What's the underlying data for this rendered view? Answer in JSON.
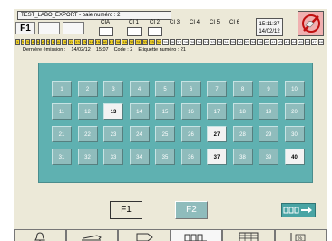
{
  "header": {
    "title": "TEST_LABO_EXPORT  - baie numéro : 2",
    "f_label": "F1",
    "columns": [
      "CIA",
      "CI 1",
      "CI 2",
      "CI 3",
      "CI 4",
      "CI 5",
      "CI 6"
    ],
    "clock_time": "15:11:37",
    "clock_date": "14/02/12",
    "close_icon": "no-entry-icon"
  },
  "markers": {
    "items": [
      "1",
      "2",
      "3",
      "4",
      "5",
      "6",
      "7",
      "8",
      "9",
      "10",
      "11",
      "12",
      "13",
      "14",
      "15",
      "16",
      "17",
      "18",
      "19",
      "20",
      "21",
      "22",
      "23",
      "24",
      "25",
      "26",
      "27",
      "28",
      "29",
      "30",
      "31",
      "32",
      "33",
      "34",
      "35",
      "36",
      "37",
      "38",
      "39",
      "40",
      "41",
      "42",
      "43",
      "44",
      "45",
      "46",
      "47",
      "48"
    ],
    "yellow_count": 24
  },
  "info": {
    "last_emission_label": "Dernière émission :",
    "last_emission_date": "14/02/12",
    "last_emission_time": "15:07",
    "code_label": "Code : 2",
    "label_number": "Etiquette numéro : 21"
  },
  "grid": {
    "cells": [
      {
        "n": "1",
        "sel": false
      },
      {
        "n": "2",
        "sel": false
      },
      {
        "n": "3",
        "sel": false
      },
      {
        "n": "4",
        "sel": false
      },
      {
        "n": "5",
        "sel": false
      },
      {
        "n": "6",
        "sel": false
      },
      {
        "n": "7",
        "sel": false
      },
      {
        "n": "8",
        "sel": false
      },
      {
        "n": "9",
        "sel": false
      },
      {
        "n": "10",
        "sel": false
      },
      {
        "n": "11",
        "sel": false
      },
      {
        "n": "12",
        "sel": false
      },
      {
        "n": "13",
        "sel": true
      },
      {
        "n": "14",
        "sel": false
      },
      {
        "n": "15",
        "sel": false
      },
      {
        "n": "16",
        "sel": false
      },
      {
        "n": "17",
        "sel": false
      },
      {
        "n": "18",
        "sel": false
      },
      {
        "n": "19",
        "sel": false
      },
      {
        "n": "20",
        "sel": false
      },
      {
        "n": "21",
        "sel": false
      },
      {
        "n": "22",
        "sel": false
      },
      {
        "n": "23",
        "sel": false
      },
      {
        "n": "24",
        "sel": false
      },
      {
        "n": "25",
        "sel": false
      },
      {
        "n": "26",
        "sel": false
      },
      {
        "n": "27",
        "sel": true
      },
      {
        "n": "28",
        "sel": false
      },
      {
        "n": "29",
        "sel": false
      },
      {
        "n": "30",
        "sel": false
      },
      {
        "n": "31",
        "sel": false
      },
      {
        "n": "32",
        "sel": false
      },
      {
        "n": "33",
        "sel": false
      },
      {
        "n": "34",
        "sel": false
      },
      {
        "n": "35",
        "sel": false
      },
      {
        "n": "36",
        "sel": false
      },
      {
        "n": "37",
        "sel": true
      },
      {
        "n": "38",
        "sel": false
      },
      {
        "n": "39",
        "sel": false
      },
      {
        "n": "40",
        "sel": true
      }
    ]
  },
  "buttons": {
    "f1": "F1",
    "f2": "F2",
    "next_icon": "rack-arrow-icon"
  },
  "bottom_tabs": [
    {
      "icon": "bell-icon"
    },
    {
      "icon": "stapler-icon"
    },
    {
      "icon": "chip-icon"
    },
    {
      "icon": "rack-icon",
      "active": true
    },
    {
      "icon": "grid-list-icon"
    },
    {
      "icon": "percent-chart-icon"
    }
  ],
  "colors": {
    "panel": "#5fb1b1",
    "cell": "#8fbcbc",
    "selected": "#f2f2f2",
    "marker_yellow": "#f2d22a"
  }
}
